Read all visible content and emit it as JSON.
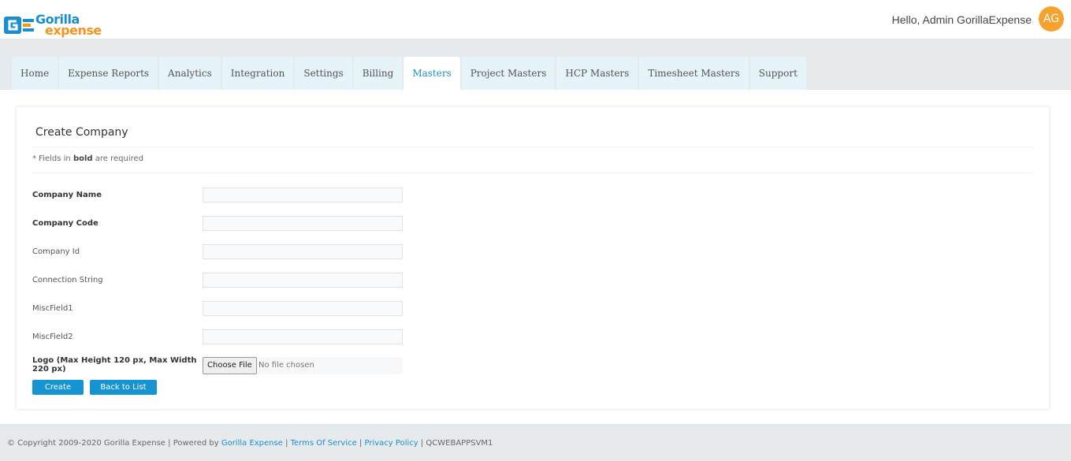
{
  "header": {
    "logo_word1": "Gorilla",
    "logo_word2": "expense",
    "greeting": "Hello, Admin GorillaExpense",
    "avatar_initials": "AG"
  },
  "nav": {
    "tabs": [
      {
        "label": "Home"
      },
      {
        "label": "Expense Reports"
      },
      {
        "label": "Analytics"
      },
      {
        "label": "Integration"
      },
      {
        "label": "Settings"
      },
      {
        "label": "Billing"
      },
      {
        "label": "Masters"
      },
      {
        "label": "Project Masters"
      },
      {
        "label": "HCP Masters"
      },
      {
        "label": "Timesheet Masters"
      },
      {
        "label": "Support"
      }
    ],
    "active_tab": "Masters"
  },
  "form": {
    "title": "Create Company",
    "note_prefix": "* Fields in ",
    "note_bold": "bold",
    "note_suffix": " are required",
    "fields": [
      {
        "label": "Company Name",
        "value": ""
      },
      {
        "label": "Company Code",
        "value": ""
      },
      {
        "label": "Company Id",
        "value": ""
      },
      {
        "label": "Connection String",
        "value": ""
      },
      {
        "label": "MiscField1",
        "value": ""
      },
      {
        "label": "MiscField2",
        "value": ""
      }
    ],
    "logo_label": "Logo (Max Height 120 px, Max Width 220 px)",
    "file_button": "Choose File",
    "file_status": "No file chosen",
    "create_label": "Create",
    "back_label": "Back to List"
  },
  "footer": {
    "copyright_symbol": "©",
    "copyright": " Copyright 2009-2020 Gorilla Expense | Powered by ",
    "powered_by_link": "Gorilla Expense",
    "sep1": " | ",
    "terms_link": "Terms Of Service",
    "sep2": " | ",
    "privacy_link": "Privacy Policy",
    "sep3": " | ",
    "server": "QCWEBAPPSVM1"
  },
  "colors": {
    "accent": "#1693d1",
    "brand_orange": "#f7941d",
    "nav_bg": "#e6eaed",
    "tab_bg": "#e6f3f8"
  }
}
